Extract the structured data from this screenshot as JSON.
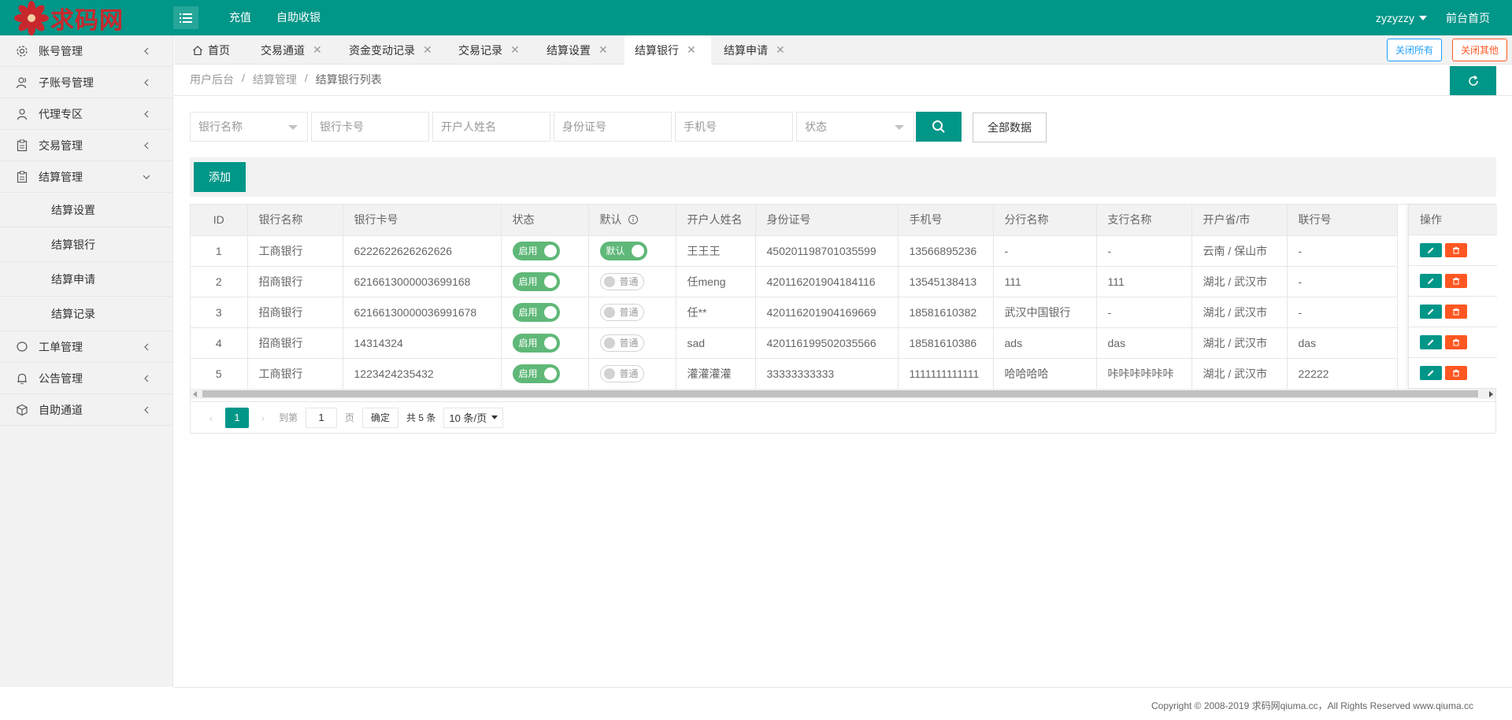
{
  "header": {
    "logo_text": "求码网",
    "nav": [
      "充值",
      "自助收银"
    ],
    "username": "zyzyzzy",
    "front_link": "前台首页",
    "bg_color": "#009688"
  },
  "sidebar": {
    "items": [
      {
        "label": "账号管理",
        "icon": "gear-icon"
      },
      {
        "label": "子账号管理",
        "icon": "users-icon"
      },
      {
        "label": "代理专区",
        "icon": "user-icon"
      },
      {
        "label": "交易管理",
        "icon": "clipboard-icon"
      },
      {
        "label": "结算管理",
        "icon": "clipboard-icon",
        "expanded": true
      }
    ],
    "subitems": [
      "结算设置",
      "结算银行",
      "结算申请",
      "结算记录"
    ],
    "items_after": [
      {
        "label": "工单管理",
        "icon": "chat-icon"
      },
      {
        "label": "公告管理",
        "icon": "bell-icon"
      },
      {
        "label": "自助通道",
        "icon": "cube-icon"
      }
    ]
  },
  "tabs": {
    "items": [
      "首页",
      "交易通道",
      "资金变动记录",
      "交易记录",
      "结算设置",
      "结算银行",
      "结算申请"
    ],
    "active": "结算银行",
    "close_all": "关闭所有",
    "close_other": "关闭其他"
  },
  "breadcrumb": [
    "用户后台",
    "结算管理",
    "结算银行列表"
  ],
  "search": {
    "bank_select": "银行名称",
    "card_placeholder": "银行卡号",
    "name_placeholder": "开户人姓名",
    "idcard_placeholder": "身份证号",
    "phone_placeholder": "手机号",
    "status_select": "状态",
    "all_button": "全部数据"
  },
  "toolbar": {
    "add_label": "添加"
  },
  "table": {
    "headers": [
      "ID",
      "银行名称",
      "银行卡号",
      "状态",
      "默认",
      "开户人姓名",
      "身份证号",
      "手机号",
      "分行名称",
      "支行名称",
      "开户省/市",
      "联行号"
    ],
    "op_header": "操作",
    "switch_on_label": "启用",
    "default_on_label": "默认",
    "default_off_label": "普通",
    "rows": [
      {
        "id": "1",
        "bank": "工商银行",
        "card": "6222622626262626",
        "status": "启用",
        "default": "默认",
        "default_on": true,
        "name": "王王王",
        "idcard": "450201198701035599",
        "phone": "13566895236",
        "branch": "-",
        "subbranch": "-",
        "region": "云南 / 保山市",
        "code": "-"
      },
      {
        "id": "2",
        "bank": "招商银行",
        "card": "6216613000003699168",
        "status": "启用",
        "default": "普通",
        "default_on": false,
        "name": "任meng",
        "idcard": "420116201904184116",
        "phone": "13545138413",
        "branch": "111",
        "subbranch": "111",
        "region": "湖北 / 武汉市",
        "code": "-"
      },
      {
        "id": "3",
        "bank": "招商银行",
        "card": "62166130000036991678",
        "status": "启用",
        "default": "普通",
        "default_on": false,
        "name": "任**",
        "idcard": "420116201904169669",
        "phone": "18581610382",
        "branch": "武汉中国银行",
        "subbranch": "-",
        "region": "湖北 / 武汉市",
        "code": "-"
      },
      {
        "id": "4",
        "bank": "招商银行",
        "card": "14314324",
        "status": "启用",
        "default": "普通",
        "default_on": false,
        "name": "sad",
        "idcard": "420116199502035566",
        "phone": "18581610386",
        "branch": "ads",
        "subbranch": "das",
        "region": "湖北 / 武汉市",
        "code": "das"
      },
      {
        "id": "5",
        "bank": "工商银行",
        "card": "1223424235432",
        "status": "启用",
        "default": "普通",
        "default_on": false,
        "name": "灌灌灌灌",
        "idcard": "33333333333",
        "phone": "1111111111111",
        "branch": "哈哈哈哈",
        "subbranch": "咔咔咔咔咔咔",
        "region": "湖北 / 武汉市",
        "code": "22222"
      }
    ]
  },
  "pager": {
    "current": "1",
    "goto_label": "到第",
    "goto_value": "1",
    "page_label": "页",
    "ok_label": "确定",
    "total": "共 5 条",
    "page_size": "10 条/页"
  },
  "footer": {
    "copyright": "Copyright © 2008-2019 求码网qiuma.cc，All Rights Reserved www.qiuma.cc"
  },
  "colors": {
    "primary": "#009688",
    "switch_on": "#5fb878",
    "danger": "#ff5722",
    "info": "#1e9fff"
  }
}
